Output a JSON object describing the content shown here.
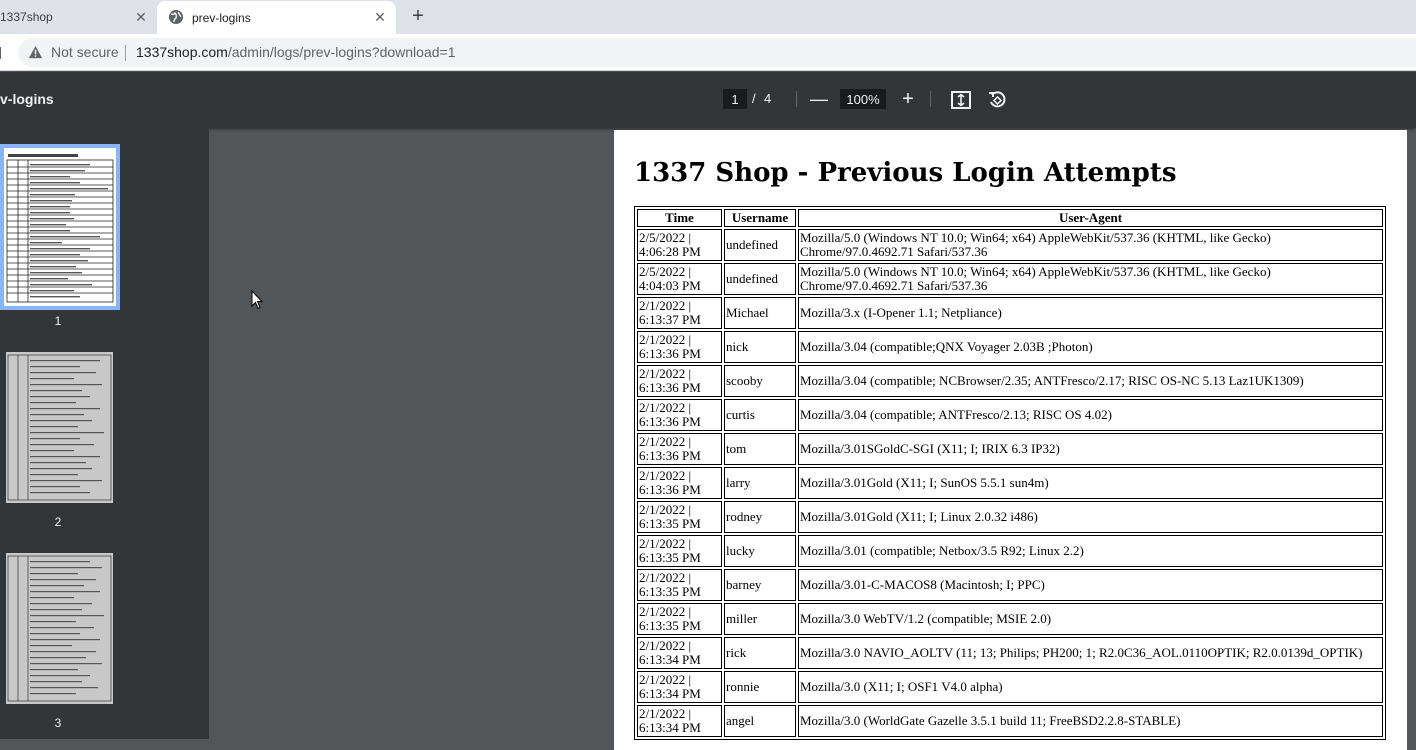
{
  "browser": {
    "tabs": [
      {
        "title": "1337shop",
        "active": false
      },
      {
        "title": "prev-logins",
        "active": true
      }
    ],
    "address": {
      "security_label": "Not secure",
      "host": "1337shop.com",
      "path": "/admin/logs/prev-logins?download=1"
    }
  },
  "pdf_toolbar": {
    "title": "v-logins",
    "current_page": "1",
    "separator": "/",
    "total_pages": "4",
    "zoom": "100%"
  },
  "thumbnails": [
    {
      "number": "1",
      "selected": true
    },
    {
      "number": "2",
      "selected": false
    },
    {
      "number": "3",
      "selected": false
    }
  ],
  "document": {
    "heading": "1337 Shop - Previous Login Attempts",
    "columns": [
      "Time",
      "Username",
      "User-Agent"
    ],
    "rows": [
      {
        "time": "2/5/2022 | 4:06:28 PM",
        "username": "undefined",
        "agent": "Mozilla/5.0 (Windows NT 10.0; Win64; x64) AppleWebKit/537.36 (KHTML, like Gecko) Chrome/97.0.4692.71 Safari/537.36"
      },
      {
        "time": "2/5/2022 | 4:04:03 PM",
        "username": "undefined",
        "agent": "Mozilla/5.0 (Windows NT 10.0; Win64; x64) AppleWebKit/537.36 (KHTML, like Gecko) Chrome/97.0.4692.71 Safari/537.36"
      },
      {
        "time": "2/1/2022 | 6:13:37 PM",
        "username": "Michael",
        "agent": "Mozilla/3.x (I-Opener 1.1; Netpliance)"
      },
      {
        "time": "2/1/2022 | 6:13:36 PM",
        "username": "nick",
        "agent": "Mozilla/3.04 (compatible;QNX Voyager 2.03B ;Photon)"
      },
      {
        "time": "2/1/2022 | 6:13:36 PM",
        "username": "scooby",
        "agent": "Mozilla/3.04 (compatible; NCBrowser/2.35; ANTFresco/2.17; RISC OS-NC 5.13 Laz1UK1309)"
      },
      {
        "time": "2/1/2022 | 6:13:36 PM",
        "username": "curtis",
        "agent": "Mozilla/3.04 (compatible; ANTFresco/2.13; RISC OS 4.02)"
      },
      {
        "time": "2/1/2022 | 6:13:36 PM",
        "username": "tom",
        "agent": "Mozilla/3.01SGoldC-SGI (X11; I; IRIX 6.3 IP32)"
      },
      {
        "time": "2/1/2022 | 6:13:36 PM",
        "username": "larry",
        "agent": "Mozilla/3.01Gold (X11; I; SunOS 5.5.1 sun4m)"
      },
      {
        "time": "2/1/2022 | 6:13:35 PM",
        "username": "rodney",
        "agent": "Mozilla/3.01Gold (X11; I; Linux 2.0.32 i486)"
      },
      {
        "time": "2/1/2022 | 6:13:35 PM",
        "username": "lucky",
        "agent": "Mozilla/3.01 (compatible; Netbox/3.5 R92; Linux 2.2)"
      },
      {
        "time": "2/1/2022 | 6:13:35 PM",
        "username": "barney",
        "agent": "Mozilla/3.01-C-MACOS8 (Macintosh; I; PPC)"
      },
      {
        "time": "2/1/2022 | 6:13:35 PM",
        "username": "miller",
        "agent": "Mozilla/3.0 WebTV/1.2 (compatible; MSIE 2.0)"
      },
      {
        "time": "2/1/2022 | 6:13:34 PM",
        "username": "rick",
        "agent": "Mozilla/3.0 NAVIO_AOLTV (11; 13; Philips; PH200; 1; R2.0C36_AOL.0110OPTIK; R2.0.0139d_OPTIK)"
      },
      {
        "time": "2/1/2022 | 6:13:34 PM",
        "username": "ronnie",
        "agent": "Mozilla/3.0 (X11; I; OSF1 V4.0 alpha)"
      },
      {
        "time": "2/1/2022 | 6:13:34 PM",
        "username": "angel",
        "agent": "Mozilla/3.0 (WorldGate Gazelle 3.5.1 build 11; FreeBSD2.2.8-STABLE)"
      }
    ]
  }
}
